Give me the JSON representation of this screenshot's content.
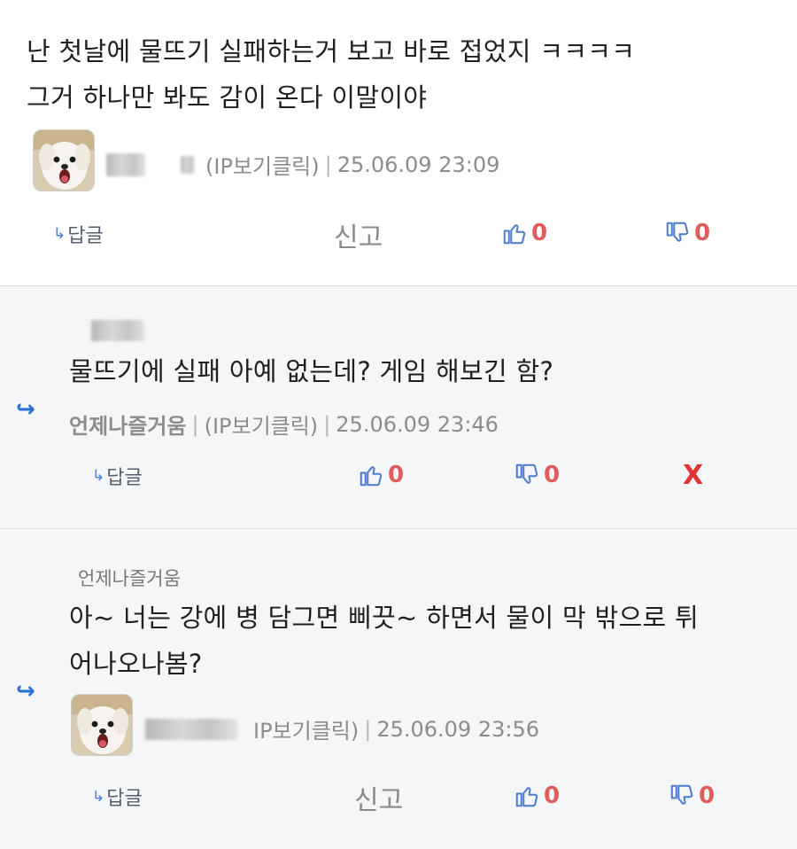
{
  "comments": [
    {
      "text_line1": "난 첫날에 물뜨기 실패하는거 보고 바로 접었지 ㅋㅋㅋㅋ",
      "text_line2": "그거 하나만 봐도 감이 온다 이말이야",
      "ip_label": "(IP보기클릭)",
      "timestamp": "25.06.09 23:09",
      "reply_label": "답글",
      "report_label": "신고",
      "up_count": "0",
      "down_count": "0"
    },
    {
      "text": "물뜨기에 실패 아예 없는데? 게임 해보긴 함?",
      "author": "언제나즐거움",
      "ip_label": "(IP보기클릭)",
      "timestamp": "25.06.09 23:46",
      "reply_label": "답글",
      "up_count": "0",
      "down_count": "0",
      "delete_label": "X"
    },
    {
      "parent": "언제나즐거움",
      "text_line1": "아~ 너는 강에 병 담그면 삐끗~ 하면서 물이 막 밖으로 튀",
      "text_line2": "어나오나봄?",
      "ip_label": "IP보기클릭)",
      "timestamp": "25.06.09 23:56",
      "reply_label": "답글",
      "report_label": "신고",
      "up_count": "0",
      "down_count": "0"
    }
  ],
  "colors": {
    "accent": "#4a7bd0",
    "count": "#e05c5c",
    "delete": "#e03434",
    "reply_bg": "#f5f6f8"
  }
}
